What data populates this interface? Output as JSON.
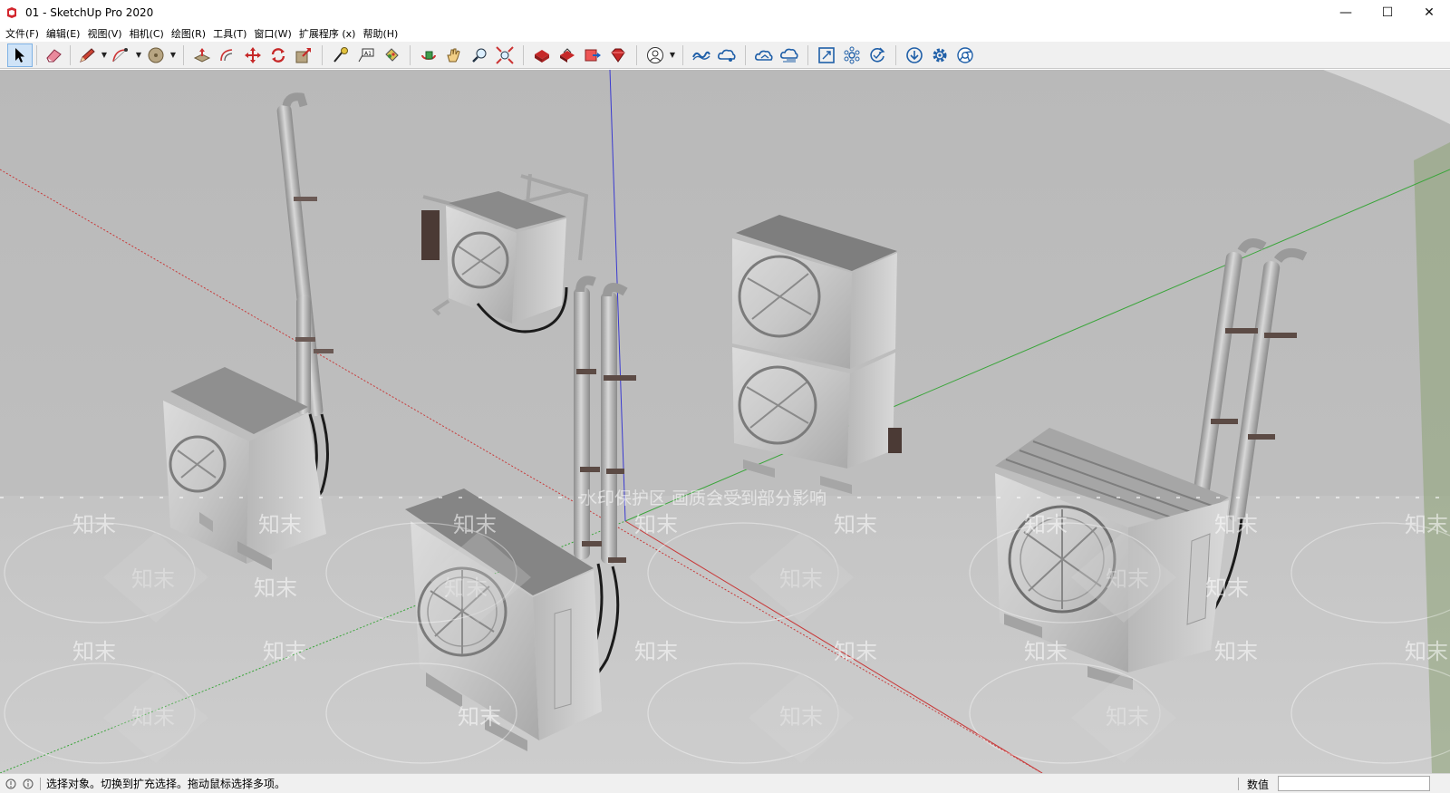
{
  "window": {
    "title": "01 - SketchUp Pro 2020",
    "controls": {
      "minimize": "—",
      "maximize": "☐",
      "close": "✕"
    }
  },
  "menu": [
    "文件(F)",
    "编辑(E)",
    "视图(V)",
    "相机(C)",
    "绘图(R)",
    "工具(T)",
    "窗口(W)",
    "扩展程序 (x)",
    "帮助(H)"
  ],
  "toolbar": {
    "tools": [
      "select-tool",
      "eraser-tool",
      "line-tool",
      "arc-tool",
      "shapes-tool",
      "push-pull-tool",
      "offset-tool",
      "move-tool",
      "rotate-tool",
      "scale-tool",
      "tape-measure-tool",
      "text-tool",
      "paint-bucket-tool",
      "orbit-tool",
      "pan-tool",
      "zoom-tool",
      "zoom-extents-tool",
      "3d-warehouse",
      "extension-warehouse",
      "layout-send",
      "extension-manager",
      "account",
      "trimble-connect",
      "trimble-connect-collab",
      "cloud-upload",
      "cloud-sync",
      "scale-figure",
      "network",
      "refresh",
      "download",
      "settings",
      "chrome"
    ],
    "active": "select-tool"
  },
  "viewport": {
    "background_colors": {
      "sky": "#bdbdbd",
      "ground": "#c8c8c8"
    },
    "axis_colors": {
      "red": "#c83a3a",
      "green": "#3aa53a",
      "blue": "#3a3ad0"
    },
    "models": [
      "outdoor-ac-unit-left",
      "outdoor-ac-unit-wall-mounted",
      "outdoor-ac-unit-center",
      "outdoor-ac-unit-stacked",
      "outdoor-ac-unit-right"
    ],
    "watermark": {
      "banner": "水印保护区 画质会受到部分影响",
      "brand": "知末"
    }
  },
  "status": {
    "message": "选择对象。切换到扩充选择。拖动鼠标选择多项。",
    "measurements_label": "数值",
    "measurements_value": ""
  }
}
